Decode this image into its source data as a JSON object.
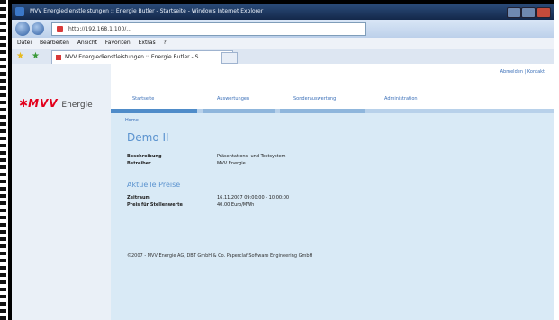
{
  "browser": {
    "title": "MVV Energiedienstleistungen :: Energie Butler - Startseite - Windows Internet Explorer",
    "url": "http://192.168.1.100/...",
    "menu": [
      "Datei",
      "Bearbeiten",
      "Ansicht",
      "Favoriten",
      "Extras",
      "?"
    ],
    "tab_title": "MVV Energiedienstleistungen :: Energie Butler - S..."
  },
  "logo": {
    "mvv": "MVV",
    "energie": "Energie"
  },
  "user_links": "Abmelden | Kontakt",
  "nav": [
    "Startseite",
    "Auswertungen",
    "Sonderauswertung",
    "Administration"
  ],
  "breadcrumb": "Home",
  "page_title": "Demo II",
  "details": [
    {
      "label": "Beschreibung",
      "value": "Präsentations- und Testsystem"
    },
    {
      "label": "Betreiber",
      "value": "MVV Energie"
    }
  ],
  "section_title": "Aktuelle Preise",
  "prices": [
    {
      "label": "Zeitraum",
      "value": "16.11.2007 09:00:00 - 10:00:00"
    },
    {
      "label": "Preis für Stellenwerte",
      "value": "40.00 Euro/MWh"
    }
  ],
  "footer": "©2007 - MVV Energie AG, DBT GmbH & Co. Paperclaf Software Engineering GmbH"
}
